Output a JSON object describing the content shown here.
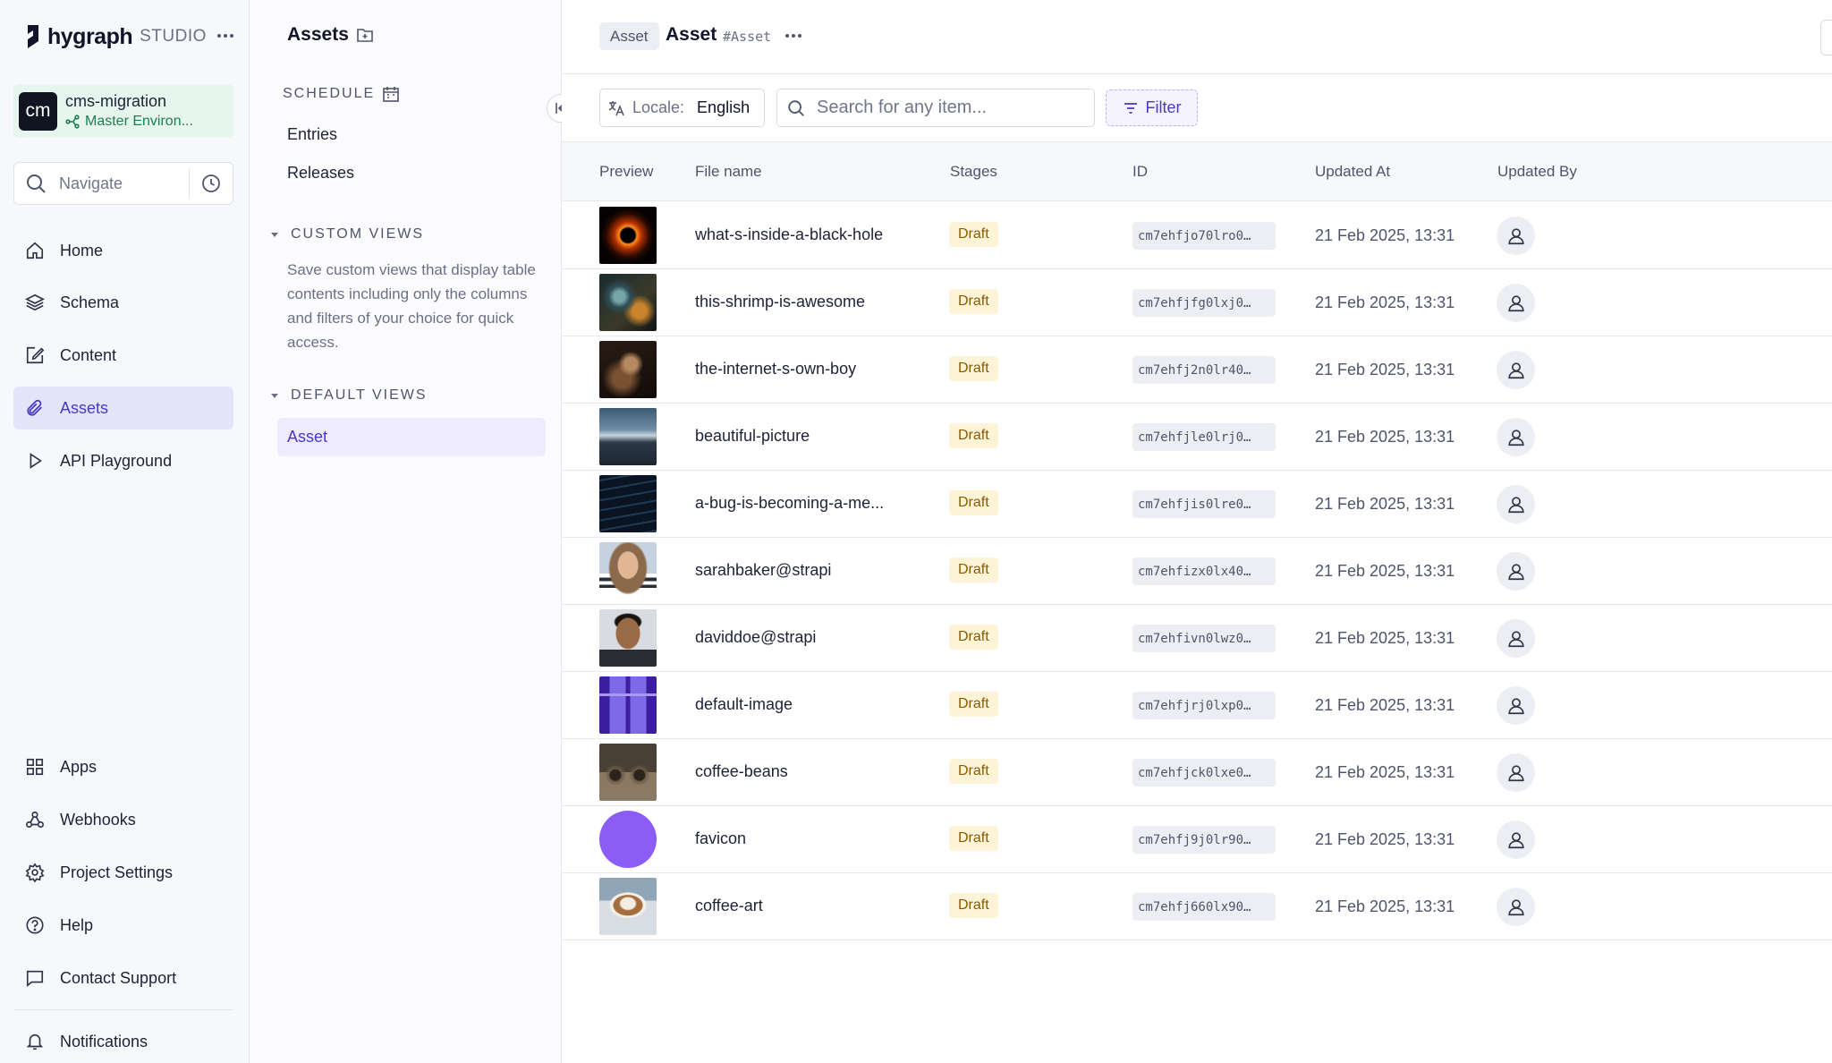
{
  "app": {
    "logo_text": "hygraph",
    "logo_sub": "STUDIO"
  },
  "project": {
    "avatar_initials": "cm",
    "name": "cms-migration",
    "environment": "Master Environ..."
  },
  "navigate": {
    "label": "Navigate"
  },
  "nav": {
    "items": [
      {
        "label": "Home",
        "icon": "home-icon"
      },
      {
        "label": "Schema",
        "icon": "layers-icon"
      },
      {
        "label": "Content",
        "icon": "edit-icon"
      },
      {
        "label": "Assets",
        "icon": "paperclip-icon",
        "active": true
      },
      {
        "label": "API Playground",
        "icon": "play-icon"
      },
      {
        "label": "Apps",
        "icon": "grid-icon"
      },
      {
        "label": "Webhooks",
        "icon": "webhook-icon"
      },
      {
        "label": "Project Settings",
        "icon": "gear-icon"
      },
      {
        "label": "Help",
        "icon": "help-icon"
      },
      {
        "label": "Contact Support",
        "icon": "chat-icon"
      },
      {
        "label": "Notifications",
        "icon": "bell-icon"
      }
    ]
  },
  "sub": {
    "title": "Assets",
    "schedule_heading": "SCHEDULE",
    "schedule_links": [
      "Entries",
      "Releases"
    ],
    "custom_views_heading": "CUSTOM VIEWS",
    "custom_views_desc": "Save custom views that display table contents including only the columns and filters of your choice for quick access.",
    "default_views_heading": "DEFAULT VIEWS",
    "default_view_item": "Asset"
  },
  "header": {
    "badge": "Asset",
    "title": "Asset",
    "api_id": "#Asset"
  },
  "toolbar": {
    "locale_label": "Locale:",
    "locale_value": "English",
    "search_placeholder": "Search for any item...",
    "filter_label": "Filter"
  },
  "table": {
    "columns": [
      "Preview",
      "File name",
      "Stages",
      "ID",
      "Updated At",
      "Updated By"
    ],
    "rows": [
      {
        "file": "what-s-inside-a-black-hole",
        "stage": "Draft",
        "id": "cm7ehfjo70lro0…",
        "updated": "21 Feb 2025, 13:31"
      },
      {
        "file": "this-shrimp-is-awesome",
        "stage": "Draft",
        "id": "cm7ehfjfg0lxj0…",
        "updated": "21 Feb 2025, 13:31"
      },
      {
        "file": "the-internet-s-own-boy",
        "stage": "Draft",
        "id": "cm7ehfj2n0lr40…",
        "updated": "21 Feb 2025, 13:31"
      },
      {
        "file": "beautiful-picture",
        "stage": "Draft",
        "id": "cm7ehfjle0lrj0…",
        "updated": "21 Feb 2025, 13:31"
      },
      {
        "file": "a-bug-is-becoming-a-me...",
        "stage": "Draft",
        "id": "cm7ehfjis0lre0…",
        "updated": "21 Feb 2025, 13:31"
      },
      {
        "file": "sarahbaker@strapi",
        "stage": "Draft",
        "id": "cm7ehfizx0lx40…",
        "updated": "21 Feb 2025, 13:31"
      },
      {
        "file": "daviddoe@strapi",
        "stage": "Draft",
        "id": "cm7ehfivn0lwz0…",
        "updated": "21 Feb 2025, 13:31"
      },
      {
        "file": "default-image",
        "stage": "Draft",
        "id": "cm7ehfjrj0lxp0…",
        "updated": "21 Feb 2025, 13:31"
      },
      {
        "file": "coffee-beans",
        "stage": "Draft",
        "id": "cm7ehfjck0lxe0…",
        "updated": "21 Feb 2025, 13:31"
      },
      {
        "file": "favicon",
        "stage": "Draft",
        "id": "cm7ehfj9j0lr90…",
        "updated": "21 Feb 2025, 13:31"
      },
      {
        "file": "coffee-art",
        "stage": "Draft",
        "id": "cm7ehfj660lx90…",
        "updated": "21 Feb 2025, 13:31"
      }
    ]
  },
  "colors": {
    "accent": "#4a38c7",
    "active_nav_bg": "#e6e4fb",
    "draft_badge_bg": "#fdf4d8",
    "draft_badge_text": "#8a5a00",
    "env_green": "#1a7f52"
  }
}
